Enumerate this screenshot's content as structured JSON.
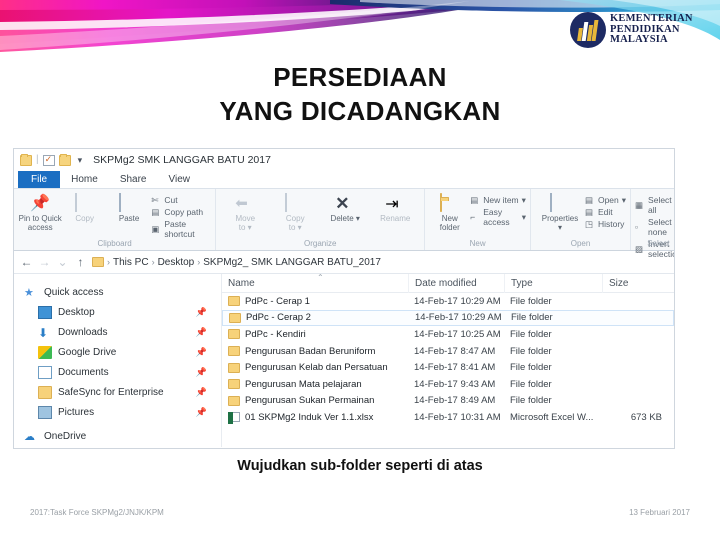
{
  "slide": {
    "title_line1": "PERSEDIAAN",
    "title_line2": "YANG DICADANGKAN",
    "caption": "Wujudkan sub-folder seperti di atas",
    "accent_magenta": "#e515c8",
    "accent_pink": "#ff2f87",
    "accent_navy": "#1b2a6b",
    "accent_cyan": "#2ec6e8"
  },
  "logo": {
    "line1": "KEMENTERIAN",
    "line2": "PENDIDIKAN",
    "line3": "MALAYSIA"
  },
  "footer": {
    "left": "2017:Task Force SKPMg2/JNJK/KPM",
    "right": "13 Februari 2017"
  },
  "explorer": {
    "window_title": "SKPMg2  SMK LANGGAR BATU 2017",
    "quick_access": {
      "folder_icon": "folder-icon",
      "properties_icon": "properties-icon",
      "caret_icon": "chevron-down-icon"
    },
    "tabs": [
      {
        "label": "File",
        "active_blue": true
      },
      {
        "label": "Home",
        "active_blue": false
      },
      {
        "label": "Share",
        "active_blue": false
      },
      {
        "label": "View",
        "active_blue": false
      }
    ],
    "ribbon": {
      "groups": [
        {
          "name": "Clipboard",
          "big": [
            {
              "label": "Pin to Quick\naccess",
              "icon": "pin-icon",
              "dim": false
            },
            {
              "label": "Copy",
              "icon": "copy-icon",
              "dim": true
            },
            {
              "label": "Paste",
              "icon": "paste-icon",
              "dim": false
            }
          ],
          "small": [
            {
              "label": "Cut",
              "icon": "scissors-icon"
            },
            {
              "label": "Copy path",
              "icon": "copy-path-icon"
            },
            {
              "label": "Paste shortcut",
              "icon": "paste-shortcut-icon"
            }
          ]
        },
        {
          "name": "Organize",
          "big": [
            {
              "label": "Move\nto",
              "icon": "move-to-icon",
              "dim": true
            },
            {
              "label": "Copy\nto",
              "icon": "copy-to-icon",
              "dim": true
            },
            {
              "label": "Delete",
              "icon": "delete-icon",
              "dim": false
            },
            {
              "label": "Rename",
              "icon": "rename-icon",
              "dim": true
            }
          ],
          "small": []
        },
        {
          "name": "New",
          "big": [
            {
              "label": "New\nfolder",
              "icon": "new-folder-icon",
              "dim": false
            }
          ],
          "small": [
            {
              "label": "New item",
              "icon": "new-item-icon"
            },
            {
              "label": "Easy access",
              "icon": "easy-access-icon"
            }
          ]
        },
        {
          "name": "Open",
          "big": [
            {
              "label": "Properties",
              "icon": "properties-icon",
              "dim": false
            }
          ],
          "small": [
            {
              "label": "Open",
              "icon": "open-icon"
            },
            {
              "label": "Edit",
              "icon": "edit-icon"
            },
            {
              "label": "History",
              "icon": "history-icon"
            }
          ]
        },
        {
          "name": "Select",
          "big": [],
          "small": [
            {
              "label": "Select all",
              "icon": "select-all-icon"
            },
            {
              "label": "Select none",
              "icon": "select-none-icon"
            },
            {
              "label": "Invert selection",
              "icon": "invert-selection-icon"
            }
          ]
        }
      ]
    },
    "address_bar": {
      "back_icon": "back-arrow-icon",
      "forward_icon": "forward-arrow-icon",
      "recent_icon": "chevron-down-icon",
      "up_icon": "up-arrow-icon",
      "crumbs": [
        "This PC",
        "Desktop",
        "SKPMg2_ SMK LANGGAR BATU_2017"
      ]
    },
    "nav_pane": [
      {
        "label": "Quick access",
        "icon": "star-icon",
        "level": "root",
        "pinned": false
      },
      {
        "label": "Desktop",
        "icon": "desktop-icon",
        "level": "child",
        "pinned": true
      },
      {
        "label": "Downloads",
        "icon": "download-icon",
        "level": "child",
        "pinned": true
      },
      {
        "label": "Google Drive",
        "icon": "google-drive-icon",
        "level": "child",
        "pinned": true
      },
      {
        "label": "Documents",
        "icon": "documents-icon",
        "level": "child",
        "pinned": true
      },
      {
        "label": "SafeSync for Enterprise",
        "icon": "folder-icon",
        "level": "child",
        "pinned": true
      },
      {
        "label": "Pictures",
        "icon": "pictures-icon",
        "level": "child",
        "pinned": true
      },
      {
        "label": "OneDrive",
        "icon": "onedrive-icon",
        "level": "root",
        "pinned": false
      }
    ],
    "columns": [
      "Name",
      "Date modified",
      "Type",
      "Size"
    ],
    "sort_indicator": "sort-ascending-icon",
    "rows": [
      {
        "name": "PdPc - Cerap 1",
        "date": "14-Feb-17 10:29 AM",
        "type": "File folder",
        "size": "",
        "icon": "folder-icon",
        "selected": false
      },
      {
        "name": "PdPc - Cerap 2",
        "date": "14-Feb-17 10:29 AM",
        "type": "File folder",
        "size": "",
        "icon": "folder-icon",
        "selected": true
      },
      {
        "name": "PdPc - Kendiri",
        "date": "14-Feb-17 10:25 AM",
        "type": "File folder",
        "size": "",
        "icon": "folder-icon",
        "selected": false
      },
      {
        "name": "Pengurusan Badan Beruniform",
        "date": "14-Feb-17 8:47 AM",
        "type": "File folder",
        "size": "",
        "icon": "folder-icon",
        "selected": false
      },
      {
        "name": "Pengurusan Kelab dan Persatuan",
        "date": "14-Feb-17 8:41 AM",
        "type": "File folder",
        "size": "",
        "icon": "folder-icon",
        "selected": false
      },
      {
        "name": "Pengurusan Mata pelajaran",
        "date": "14-Feb-17 9:43 AM",
        "type": "File folder",
        "size": "",
        "icon": "folder-icon",
        "selected": false
      },
      {
        "name": "Pengurusan Sukan Permainan",
        "date": "14-Feb-17 8:49 AM",
        "type": "File folder",
        "size": "",
        "icon": "folder-icon",
        "selected": false
      },
      {
        "name": "01 SKPMg2 Induk Ver 1.1.xlsx",
        "date": "14-Feb-17 10:31 AM",
        "type": "Microsoft Excel W...",
        "size": "673 KB",
        "icon": "excel-icon",
        "selected": false
      }
    ]
  }
}
